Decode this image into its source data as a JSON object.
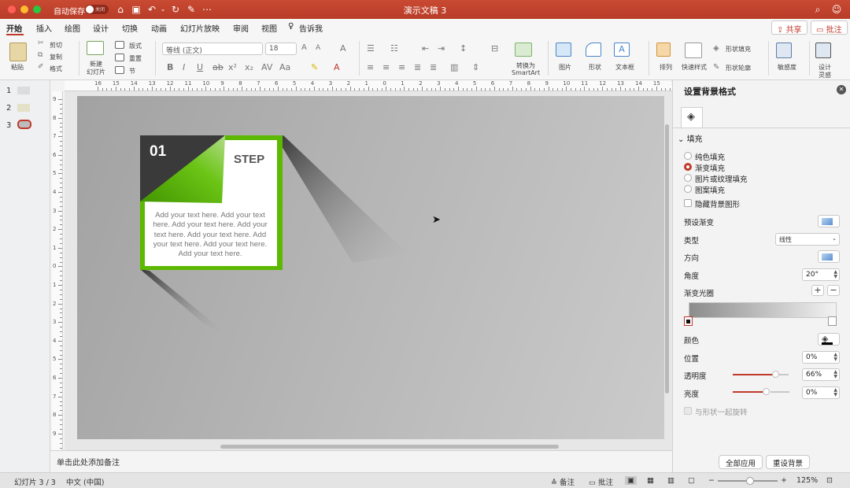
{
  "titlebar": {
    "autosave_label": "自动保存",
    "toggle_text": "关闭",
    "doc_title": "演示文稿 3"
  },
  "tabs": [
    {
      "label": "开始",
      "active": true
    },
    {
      "label": "插入"
    },
    {
      "label": "绘图"
    },
    {
      "label": "设计"
    },
    {
      "label": "切换"
    },
    {
      "label": "动画"
    },
    {
      "label": "幻灯片放映"
    },
    {
      "label": "审阅"
    },
    {
      "label": "视图"
    },
    {
      "label": "告诉我"
    }
  ],
  "top_buttons": {
    "share": "共享",
    "comment": "批注"
  },
  "ribbon": {
    "paste": "粘贴",
    "cut": "剪切",
    "copy": "复制",
    "format": "格式",
    "new_slide_line1": "新建",
    "new_slide_line2": "幻灯片",
    "layout": "版式",
    "reset": "重置",
    "section": "节",
    "font_name": "等线 (正文)",
    "font_size": "18",
    "convert_line1": "转换为",
    "convert_line2": "SmartArt",
    "picture": "图片",
    "shape": "形状",
    "textbox": "文本框",
    "arrange": "排列",
    "quick_styles": "快速样式",
    "shape_fill": "形状填充",
    "shape_outline": "形状轮廓",
    "sensitivity": "敏感度",
    "designer_line1": "设计",
    "designer_line2": "灵感"
  },
  "thumbnails": [
    "1",
    "2",
    "3"
  ],
  "ruler": {
    "h_labels": [
      "16",
      "15",
      "14",
      "13",
      "12",
      "11",
      "10",
      "9",
      "8",
      "7",
      "6",
      "5",
      "4",
      "3",
      "2",
      "1",
      "0",
      "1",
      "2",
      "3",
      "4",
      "5",
      "6",
      "7",
      "8",
      "9",
      "10",
      "11",
      "12",
      "13",
      "14",
      "15",
      "16"
    ],
    "v_labels": [
      "9",
      "8",
      "7",
      "6",
      "5",
      "4",
      "3",
      "2",
      "1",
      "0",
      "1",
      "2",
      "3",
      "4",
      "5",
      "6",
      "7",
      "8",
      "9"
    ]
  },
  "slide": {
    "number": "01",
    "step": "STEP",
    "body": "Add your text here. Add your text here. Add your text here. Add your text here. Add your text here. Add your text here. Add your text here. Add your text here.",
    "accent_color": "#5cb800",
    "dark_color": "#3a3a3a"
  },
  "notes": {
    "placeholder": "单击此处添加备注"
  },
  "pane": {
    "title": "设置背景格式",
    "section": "填充",
    "options": [
      "纯色填充",
      "渐变填充",
      "图片或纹理填充",
      "图案填充"
    ],
    "selected_option": "渐变填充",
    "hide_bg_graphics": "隐藏背景图形",
    "preset_label": "预设渐变",
    "type_label": "类型",
    "type_value": "线性",
    "direction_label": "方向",
    "angle_label": "角度",
    "angle_value": "20°",
    "stops_label": "渐变光圈",
    "color_label": "颜色",
    "position_label": "位置",
    "position_value": "0%",
    "transparency_label": "透明度",
    "transparency_value": "66%",
    "brightness_label": "亮度",
    "brightness_value": "0%",
    "rotate_with_shape": "与形状一起旋转",
    "apply_all": "全部应用",
    "reset_bg": "重设背景"
  },
  "statusbar": {
    "slide_info": "幻灯片 3 / 3",
    "language": "中文 (中国)",
    "notes": "备注",
    "comments": "批注",
    "zoom": "125%"
  }
}
